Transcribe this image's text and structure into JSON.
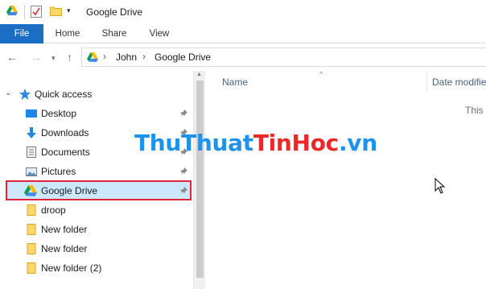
{
  "window": {
    "title": "Google Drive"
  },
  "ribbon": {
    "tabs": [
      {
        "label": "File",
        "active": true
      },
      {
        "label": "Home"
      },
      {
        "label": "Share"
      },
      {
        "label": "View"
      }
    ]
  },
  "address": {
    "breadcrumb": [
      "John",
      "Google Drive"
    ]
  },
  "navigation": {
    "quick_access_label": "Quick access",
    "items": [
      {
        "label": "Desktop",
        "icon": "desktop-icon",
        "pinned": true
      },
      {
        "label": "Downloads",
        "icon": "downloads-icon",
        "pinned": true
      },
      {
        "label": "Documents",
        "icon": "documents-icon",
        "pinned": true
      },
      {
        "label": "Pictures",
        "icon": "pictures-icon",
        "pinned": true
      },
      {
        "label": "Google Drive",
        "icon": "google-drive-icon",
        "pinned": true,
        "selected": true
      },
      {
        "label": "droop",
        "icon": "folder-icon",
        "pinned": false
      },
      {
        "label": "New folder",
        "icon": "folder-icon",
        "pinned": false
      },
      {
        "label": "New folder",
        "icon": "folder-icon",
        "pinned": false
      },
      {
        "label": "New folder (2)",
        "icon": "folder-icon",
        "pinned": false
      }
    ]
  },
  "content": {
    "columns": [
      "Name",
      "Date modifie"
    ],
    "empty_message": "This f"
  },
  "watermark": {
    "part1": "ThuThuat",
    "part2": "TinHoc",
    "part3": ".vn"
  },
  "colors": {
    "file_tab": "#1a6fc4",
    "selection_bg": "#cce8ff",
    "selection_outline": "#e0233a",
    "watermark_blue": "#1f93ea",
    "watermark_red": "#ea2a2a"
  }
}
